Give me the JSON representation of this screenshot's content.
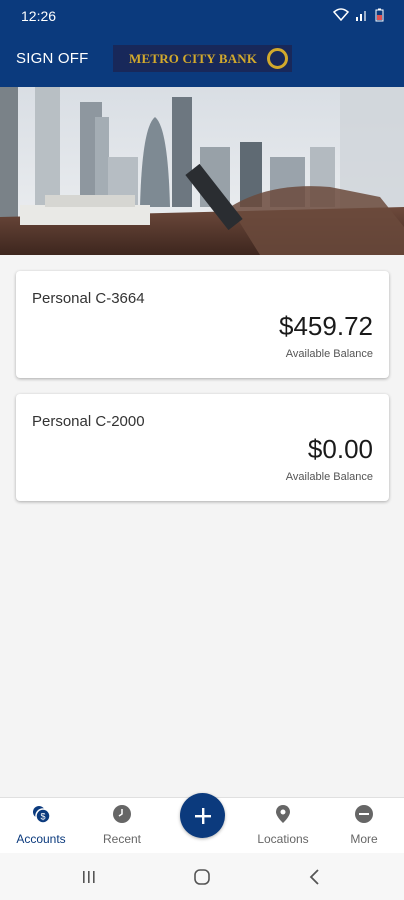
{
  "status_bar": {
    "time": "12:26"
  },
  "header": {
    "sign_off_label": "SIGN OFF",
    "bank_name": "METRO CITY BANK"
  },
  "accounts": [
    {
      "name": "Personal C-3664",
      "balance": "$459.72",
      "balance_label": "Available Balance"
    },
    {
      "name": "Personal C-2000",
      "balance": "$0.00",
      "balance_label": "Available Balance"
    }
  ],
  "bottom_nav": {
    "items": [
      {
        "label": "Accounts",
        "icon": "accounts-icon",
        "active": true
      },
      {
        "label": "Recent",
        "icon": "clock-icon",
        "active": false
      },
      {
        "label": "Locations",
        "icon": "location-pin-icon",
        "active": false
      },
      {
        "label": "More",
        "icon": "more-icon",
        "active": false
      }
    ],
    "fab_icon": "plus-icon"
  },
  "colors": {
    "brand_blue": "#0b3a7d",
    "logo_gold": "#d2a92c",
    "logo_bg": "#18285a"
  }
}
